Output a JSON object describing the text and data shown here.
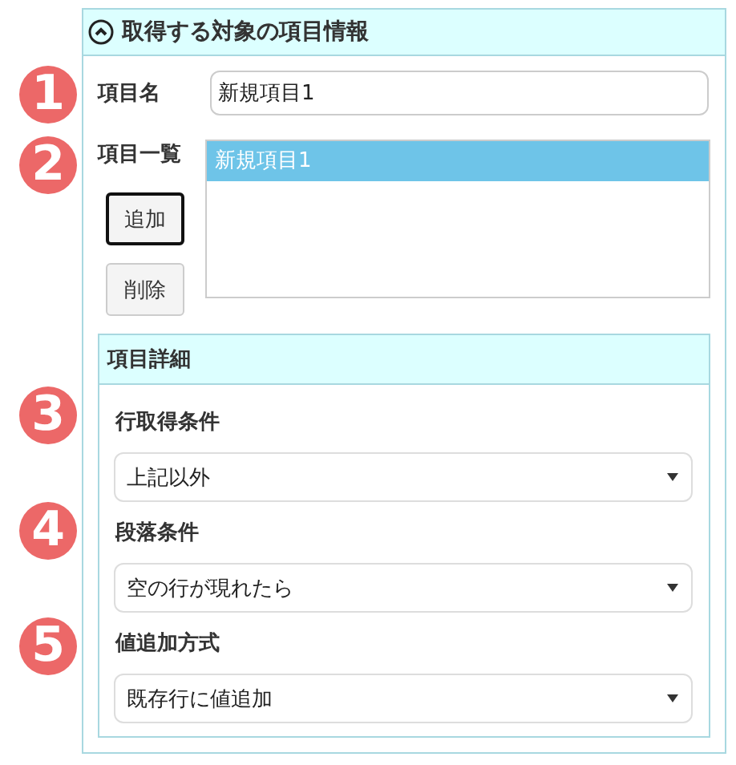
{
  "panel": {
    "title": "取得する対象の項目情報",
    "expanded": true
  },
  "name_field": {
    "label": "項目名",
    "value": "新規項目1"
  },
  "item_list": {
    "label": "項目一覧",
    "items": [
      {
        "label": "新規項目1",
        "selected": true
      }
    ]
  },
  "buttons": [
    {
      "label": "追加",
      "focused": true
    },
    {
      "label": "削除",
      "focused": false
    }
  ],
  "detail": {
    "title": "項目詳細",
    "fields": [
      {
        "label": "行取得条件",
        "value": "上記以外"
      },
      {
        "label": "段落条件",
        "value": "空の行が現れたら"
      },
      {
        "label": "値追加方式",
        "value": "既存行に値追加"
      }
    ]
  },
  "badges": [
    "1",
    "2",
    "3",
    "4",
    "5"
  ]
}
